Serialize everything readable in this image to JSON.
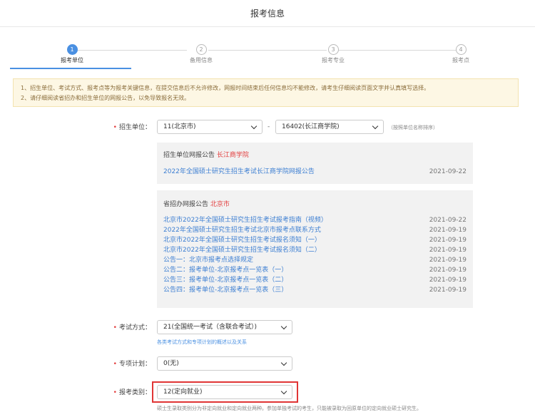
{
  "header": {
    "title": "报考信息"
  },
  "steps": [
    {
      "num": "1",
      "label": "报考单位"
    },
    {
      "num": "2",
      "label": "备用信息"
    },
    {
      "num": "3",
      "label": "报考专业"
    },
    {
      "num": "4",
      "label": "报考点"
    }
  ],
  "notice": {
    "line1": "1、招生单位、考试方式、报考点等为报考关键信息，在提交信息后不允许修改，网报时间结束后任何信息均不能修改，请考生仔细阅读页面文字并认真填写选择。",
    "line2": "2、请仔细阅读省招办和招生单位的网报公告，以免导致报名无效。"
  },
  "form": {
    "unit": {
      "label": "招生单位：",
      "province": "11(北京市)",
      "dash": "-",
      "school": "16402(长江商学院)",
      "sort_hint": "（按照单位名称排序）"
    },
    "unit_panel": {
      "title": "招生单位网报公告",
      "title_red": "长江商学院",
      "items": [
        {
          "text": "2022年全国硕士研究生招生考试长江商学院网报公告",
          "date": "2021-09-22"
        }
      ]
    },
    "prov_panel": {
      "title": "省招办网报公告",
      "title_red": "北京市",
      "items": [
        {
          "text": "北京市2022年全国硕士研究生招生考试报考指南（视频）",
          "date": "2021-09-22"
        },
        {
          "text": "2022年全国硕士研究生招生考试北京市报考点联系方式",
          "date": "2021-09-19"
        },
        {
          "text": "北京市2022年全国硕士研究生招生考试报名须知（一）",
          "date": "2021-09-19"
        },
        {
          "text": "北京市2022年全国硕士研究生招生考试报名须知（二）",
          "date": "2021-09-19"
        },
        {
          "text": "公告一：北京市报考点选择规定",
          "date": "2021-09-19"
        },
        {
          "text": "公告二：报考单位-北京报考点一览表（一）",
          "date": "2021-09-19"
        },
        {
          "text": "公告三：报考单位-北京报考点一览表（二）",
          "date": "2021-09-19"
        },
        {
          "text": "公告四：报考单位-北京报考点一览表（三）",
          "date": "2021-09-19"
        }
      ]
    },
    "exam": {
      "label": "考试方式：",
      "value": "21(全国统一考试（含联合考试）)",
      "hint": "各类考试方式和专项计划的概述以及关系"
    },
    "special": {
      "label": "专项计划：",
      "value": "0(无)"
    },
    "category": {
      "label": "报考类别：",
      "value": "12(定向就业)",
      "hint": "硕士生录取类别分为非定向就业和定向就业两种。参加单独考试的考生，只能被录取为回原单位的定向就业硕士研究生。"
    },
    "required_mark": "•"
  },
  "colors": {
    "accent": "#4a90e2",
    "highlight": "#e03535",
    "required": "#e23d3d"
  }
}
